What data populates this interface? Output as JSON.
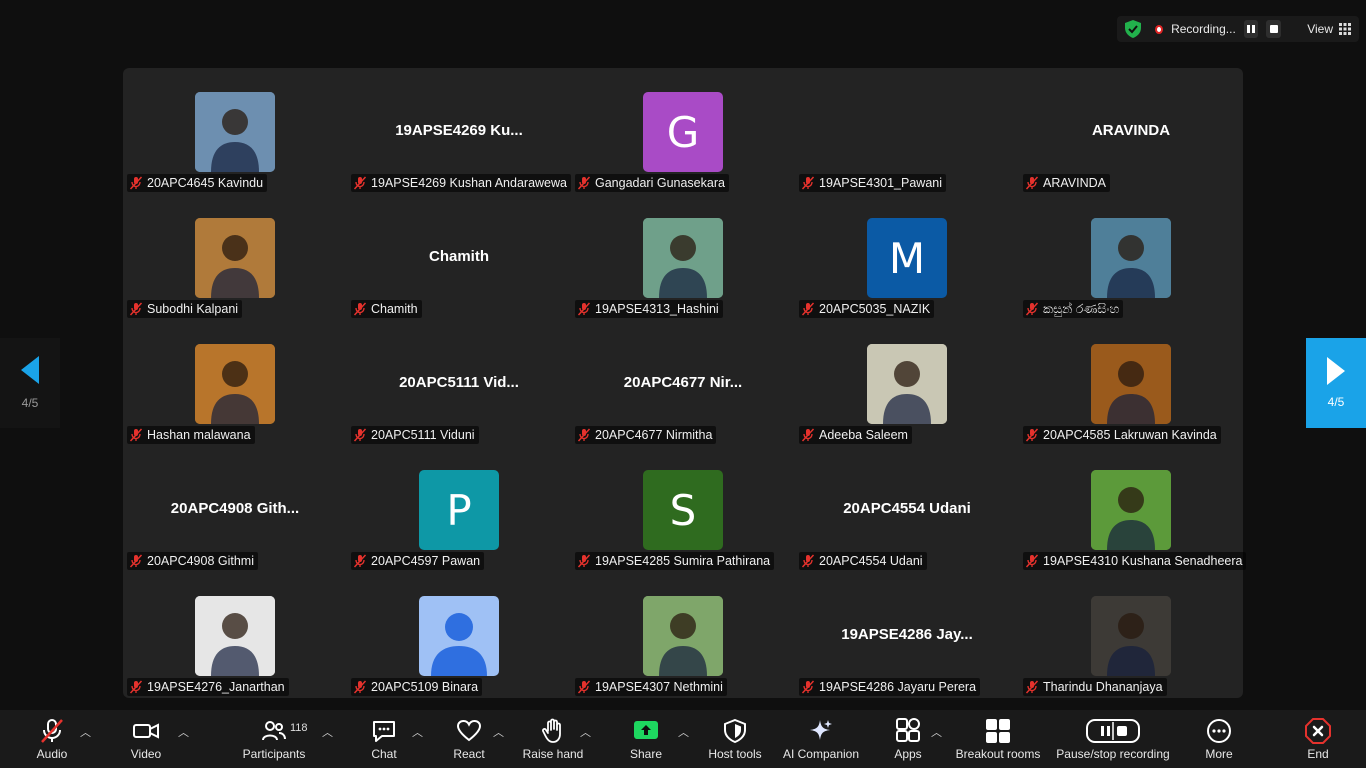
{
  "recording": {
    "status_text": "Recording...",
    "view_label": "View"
  },
  "pager": {
    "page_text": "4/5"
  },
  "tiles": [
    {
      "name": "20APC4645 Kavindu",
      "display": "photo",
      "avatar_color": "#6d8fb0"
    },
    {
      "name": "19APSE4269 Kushan Andarawewa",
      "display": "text",
      "big_text": "19APSE4269 Ku..."
    },
    {
      "name": "Gangadari Gunasekara",
      "display": "letter",
      "letter": "G",
      "avatar_color": "#a94bc6"
    },
    {
      "name": "19APSE4301_Pawani",
      "display": "none"
    },
    {
      "name": "ARAVINDA",
      "display": "text",
      "big_text": "ARAVINDA"
    },
    {
      "name": "Subodhi Kalpani",
      "display": "photo",
      "avatar_color": "#b07a3a"
    },
    {
      "name": "Chamith",
      "display": "text",
      "big_text": "Chamith"
    },
    {
      "name": "19APSE4313_Hashini",
      "display": "photo",
      "avatar_color": "#6fa08a"
    },
    {
      "name": "20APC5035_NAZIK",
      "display": "letter",
      "letter": "M",
      "avatar_color": "#0b5aa5"
    },
    {
      "name": "කසුන් රණසිංහ",
      "display": "photo",
      "avatar_color": "#4f7f99"
    },
    {
      "name": "Hashan malawana",
      "display": "photo",
      "avatar_color": "#b8752b"
    },
    {
      "name": "20APC5111 Viduni",
      "display": "text",
      "big_text": "20APC5111 Vid..."
    },
    {
      "name": "20APC4677 Nirmitha",
      "display": "text",
      "big_text": "20APC4677 Nir..."
    },
    {
      "name": "Adeeba Saleem",
      "display": "photo",
      "avatar_color": "#c9c7b4"
    },
    {
      "name": "20APC4585 Lakruwan Kavinda",
      "display": "photo",
      "avatar_color": "#9a5a1c"
    },
    {
      "name": "20APC4908 Githmi",
      "display": "text",
      "big_text": "20APC4908 Gith..."
    },
    {
      "name": "20APC4597 Pawan",
      "display": "letter",
      "letter": "P",
      "avatar_color": "#0e98a6"
    },
    {
      "name": "19APSE4285 Sumira Pathirana",
      "display": "letter",
      "letter": "S",
      "avatar_color": "#2f6b1f"
    },
    {
      "name": "20APC4554 Udani",
      "display": "text",
      "big_text": "20APC4554 Udani"
    },
    {
      "name": "19APSE4310 Kushana Senadheera",
      "display": "photo",
      "avatar_color": "#5c9a3a"
    },
    {
      "name": "19APSE4276_Janarthan",
      "display": "photo",
      "avatar_color": "#e6e6e6"
    },
    {
      "name": "20APC5109 Binara",
      "display": "default",
      "avatar_color": "#9fc1f5"
    },
    {
      "name": "19APSE4307 Nethmini",
      "display": "photo",
      "avatar_color": "#7fa66a"
    },
    {
      "name": "19APSE4286 Jayaru Perera",
      "display": "text",
      "big_text": "19APSE4286 Jay..."
    },
    {
      "name": "Tharindu Dhananjaya",
      "display": "photo",
      "avatar_color": "#3d3a36"
    }
  ],
  "toolbar": {
    "audio": "Audio",
    "video": "Video",
    "participants": "Participants",
    "participants_count": "118",
    "chat": "Chat",
    "react": "React",
    "raise_hand": "Raise hand",
    "share": "Share",
    "host_tools": "Host tools",
    "ai_companion": "AI Companion",
    "apps": "Apps",
    "breakout_rooms": "Breakout rooms",
    "pause_stop_recording": "Pause/stop recording",
    "more": "More",
    "end": "End"
  },
  "colors": {
    "share_accent": "#1ed760",
    "end_accent": "#e5322d",
    "pager_accent": "#1aa3e8"
  }
}
